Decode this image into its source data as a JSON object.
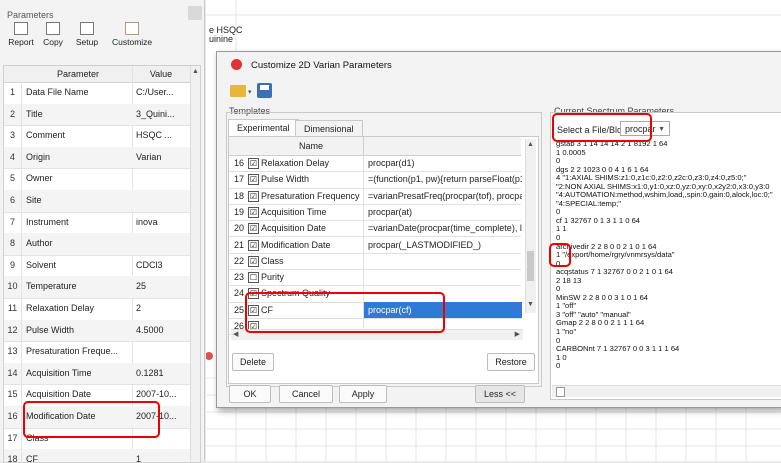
{
  "params_panel": {
    "title": "Parameters",
    "toolbar": [
      {
        "label": "Report",
        "icon": "report-icon"
      },
      {
        "label": "Copy",
        "icon": "copy-icon"
      },
      {
        "label": "Setup",
        "icon": "setup-icon"
      },
      {
        "label": "Customize",
        "icon": "customize-icon"
      }
    ],
    "columns": [
      "Parameter",
      "Value"
    ],
    "rows": [
      {
        "n": "1",
        "name": "Data File Name",
        "value": "C:/User..."
      },
      {
        "n": "2",
        "name": "Title",
        "value": "3_Quini..."
      },
      {
        "n": "3",
        "name": "Comment",
        "value": "HSQC ..."
      },
      {
        "n": "4",
        "name": "Origin",
        "value": "Varian"
      },
      {
        "n": "5",
        "name": "Owner",
        "value": ""
      },
      {
        "n": "6",
        "name": "Site",
        "value": ""
      },
      {
        "n": "7",
        "name": "Instrument",
        "value": "inova"
      },
      {
        "n": "8",
        "name": "Author",
        "value": ""
      },
      {
        "n": "9",
        "name": "Solvent",
        "value": "CDCl3"
      },
      {
        "n": "10",
        "name": "Temperature",
        "value": "25"
      },
      {
        "n": "11",
        "name": "Relaxation Delay",
        "value": "2"
      },
      {
        "n": "12",
        "name": "Pulse Width",
        "value": "4.5000"
      },
      {
        "n": "13",
        "name": "Presaturation Freque...",
        "value": ""
      },
      {
        "n": "14",
        "name": "Acquisition Time",
        "value": "0.1281"
      },
      {
        "n": "15",
        "name": "Acquisition Date",
        "value": "2007-10..."
      },
      {
        "n": "16",
        "name": "Modification Date",
        "value": "2007-10..."
      },
      {
        "n": "17",
        "name": "Class",
        "value": ""
      },
      {
        "n": "18",
        "name": "CF",
        "value": "1"
      }
    ]
  },
  "background": {
    "label1": "e HSQC",
    "label2": "uinine"
  },
  "dialog": {
    "title": "Customize 2D Varian Parameters",
    "templates_label": "Templates",
    "tabs": [
      "Experimental",
      "Dimensional"
    ],
    "table_header": "Name",
    "rows": [
      {
        "n": "16",
        "checked": "☑",
        "name": "Relaxation Delay",
        "def": "procpar(d1)"
      },
      {
        "n": "17",
        "checked": "☑",
        "name": "Pulse Width",
        "def": "=(function(p1, pw){return parseFloat(p1) ||"
      },
      {
        "n": "18",
        "checked": "☑",
        "name": "Presaturation Frequency",
        "def": "=varianPresatFreq(procpar(tof), procpar(sa"
      },
      {
        "n": "19",
        "checked": "☑",
        "name": "Acquisition Time",
        "def": "procpar(at)"
      },
      {
        "n": "20",
        "checked": "☑",
        "name": "Acquisition Date",
        "def": "=varianDate(procpar(time_complete), log(/"
      },
      {
        "n": "21",
        "checked": "☑",
        "name": "Modification Date",
        "def": "procpar(_LASTMODIFIED_)"
      },
      {
        "n": "22",
        "checked": "☑",
        "name": "Class",
        "def": ""
      },
      {
        "n": "23",
        "checked": "☐",
        "name": "Purity",
        "def": ""
      },
      {
        "n": "24",
        "checked": "☑",
        "name": "Spectrum Quality",
        "def": ""
      },
      {
        "n": "25",
        "checked": "☑",
        "name": "CF",
        "def": "procpar(cf)"
      },
      {
        "n": "26",
        "checked": "☑",
        "name": "",
        "def": ""
      }
    ],
    "delete_label": "Delete",
    "restore_label": "Restore",
    "ok_label": "OK",
    "cancel_label": "Cancel",
    "apply_label": "Apply",
    "less_label": "Less <<",
    "spectrum_panel_label": "Current Spectrum Parameters",
    "file_block_label": "Select a File/Block:",
    "file_block_value": "procpar",
    "procpar_text": "gstab 3 1 14 14 14 2 1 8192 1 64\n1 0.0005\n0\ndgs 2 2 1023 0 0 4 1 6 1 64\n4 \"1:AXIAL SHIMS:z1:0,z1c:0,z2:0,z2c:0,z3:0,z4:0,z5:0;\"\n\"2:NON AXIAL SHIMS:x1:0,y1:0,xz:0,yz:0,xy:0,x2y2:0,x3:0,y3:0\n\"4:AUTOMATION:method,wshim,load,,spin:0,gain:0,alock,loc:0;\"\n\"4:SPECIAL:temp;\"\n0\ncf 1 32767 0 1 3 1 1 0 64\n1 1\n0\narchivedir 2 2 8 0 0 2 1 0 1 64\n1 \"/export/home/rgry/vnmrsys/data\"\n0\nacqstatus 7 1 32767 0 0 2 1 0 1 64\n2 18 13\n0\nMinSW 2 2 8 0 0 3 1 0 1 64\n1 \"off\"\n3 \"off\" \"auto\" \"manual\"\nGmap 2 2 8 0 0 2 1 1 1 64\n1 \"no\"\n0\nCARBONnt 7 1 32767 0 0 3 1 1 1 64\n1 0\n0"
  }
}
